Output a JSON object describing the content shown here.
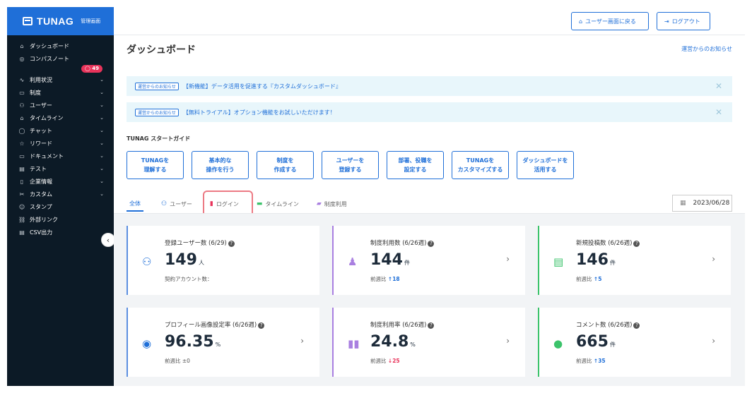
{
  "brand": {
    "name": "TUNAG",
    "sub": "管理画面"
  },
  "sidebar": {
    "items": [
      {
        "icon": "⌂",
        "label": "ダッシュボード",
        "chev": ""
      },
      {
        "icon": "◎",
        "label": "コンパスノート",
        "chev": ""
      },
      {
        "icon": "∿",
        "label": "利用状況",
        "chev": "⌄"
      },
      {
        "icon": "▭",
        "label": "制度",
        "chev": "⌄"
      },
      {
        "icon": "⚇",
        "label": "ユーザー",
        "chev": "⌄"
      },
      {
        "icon": "⌂",
        "label": "タイムライン",
        "chev": "⌄"
      },
      {
        "icon": "◯",
        "label": "チャット",
        "chev": "⌄"
      },
      {
        "icon": "☆",
        "label": "リワード",
        "chev": "⌄"
      },
      {
        "icon": "▭",
        "label": "ドキュメント",
        "chev": "⌄"
      },
      {
        "icon": "▤",
        "label": "テスト",
        "chev": "⌄"
      },
      {
        "icon": "▯",
        "label": "企業情報",
        "chev": "⌄"
      },
      {
        "icon": "✂",
        "label": "カスタム",
        "chev": "⌄"
      },
      {
        "icon": "☺",
        "label": "スタンプ",
        "chev": ""
      },
      {
        "icon": "⛓",
        "label": "外部リンク",
        "chev": ""
      },
      {
        "icon": "▤",
        "label": "CSV出力",
        "chev": ""
      }
    ],
    "badge": "49",
    "collapse": "‹"
  },
  "topbar": {
    "back_icon": "⌂",
    "back_label": "ユーザー画面に戻る",
    "logout_icon": "⇥",
    "logout_label": "ログアウト"
  },
  "page": {
    "title": "ダッシュボード",
    "notice_link": "運営からのお知らせ"
  },
  "banners": [
    {
      "tag": "運営からのお知らせ",
      "text": "【新機能】データ活用を促進する『カスタムダッシュボード』",
      "close": "✕"
    },
    {
      "tag": "運営からのお知らせ",
      "text": "【無料トライアル】オプション機能をお試しいただけます！",
      "close": "✕"
    }
  ],
  "guide": {
    "title": "TUNAG スタートガイド",
    "buttons": [
      {
        "l1": "TUNAGを",
        "l2": "理解する"
      },
      {
        "l1": "基本的な",
        "l2": "操作を行う"
      },
      {
        "l1": "制度を",
        "l2": "作成する"
      },
      {
        "l1": "ユーザーを",
        "l2": "登録する"
      },
      {
        "l1": "部署、役職を",
        "l2": "設定する"
      },
      {
        "l1": "TUNAGを",
        "l2": "カスタマイズする"
      },
      {
        "l1": "ダッシュボードを",
        "l2": "活用する"
      }
    ]
  },
  "tabs": [
    {
      "icon": "",
      "label": "全体"
    },
    {
      "icon": "⚇",
      "label": "ユーザー"
    },
    {
      "icon": "▮",
      "label": "ログイン"
    },
    {
      "icon": "▬",
      "label": "タイムライン"
    },
    {
      "icon": "▰",
      "label": "制度利用"
    }
  ],
  "date": {
    "icon": "▦",
    "value": "2023/06/28"
  },
  "cards": [
    {
      "title": "登録ユーザー数 (6/29)",
      "value": "149",
      "unit": "人",
      "sub_label": "契約アカウント数：",
      "sub_dir": "",
      "sub_value": "",
      "icon": "⚇",
      "icon_color": "#1f6fd8",
      "arrow": ""
    },
    {
      "title": "制度利用数 (6/26週)",
      "value": "144",
      "unit": "件",
      "sub_label": "前週比",
      "sub_dir": "↑",
      "sub_value": "18",
      "icon": "♟",
      "icon_color": "#a97fe0",
      "arrow": "›"
    },
    {
      "title": "新規投稿数 (6/26週)",
      "value": "146",
      "unit": "件",
      "sub_label": "前週比",
      "sub_dir": "↑",
      "sub_value": "5",
      "icon": "▤",
      "icon_color": "#3cc36b",
      "arrow": "›"
    },
    {
      "title": "プロフィール画像設定率 (6/26週)",
      "value": "96.35",
      "unit": "%",
      "sub_label": "前週比 ±0",
      "sub_dir": "",
      "sub_value": "",
      "icon": "◉",
      "icon_color": "#1f6fd8",
      "arrow": "›"
    },
    {
      "title": "制度利用率 (6/26週)",
      "value": "24.8",
      "unit": "%",
      "sub_label": "前週比",
      "sub_dir": "↓",
      "sub_value": "25",
      "icon": "▮▮",
      "icon_color": "#a97fe0",
      "arrow": "›"
    },
    {
      "title": "コメント数 (6/26週)",
      "value": "665",
      "unit": "件",
      "sub_label": "前週比",
      "sub_dir": "↑",
      "sub_value": "35",
      "icon": "●",
      "icon_color": "#3cc36b",
      "arrow": "›"
    }
  ],
  "question_mark": "?"
}
